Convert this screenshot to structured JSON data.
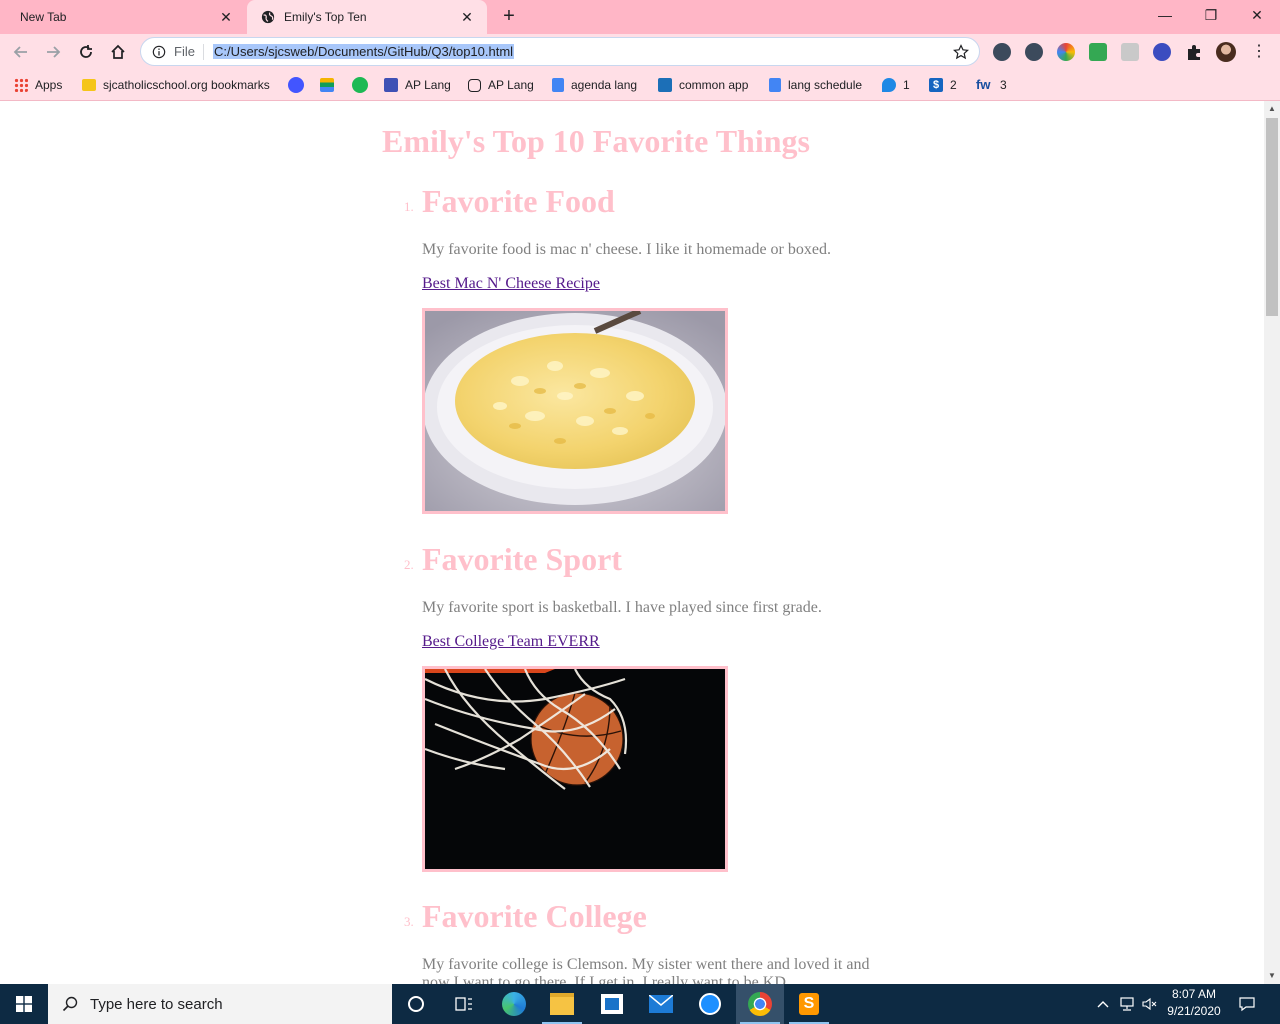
{
  "browser": {
    "tabs": [
      {
        "label": "New Tab",
        "active": false
      },
      {
        "label": "Emily's Top Ten",
        "active": true
      }
    ],
    "address_scheme": "File",
    "address_url": "C:/Users/sjcsweb/Documents/GitHub/Q3/top10.html",
    "bookmarks": [
      {
        "label": "Apps",
        "icon": "apps-grid-icon"
      },
      {
        "label": "sjcatholicschool.org bookmarks",
        "icon": "folder-icon"
      },
      {
        "label": "",
        "icon": "quizlet-icon"
      },
      {
        "label": "",
        "icon": "layers-icon"
      },
      {
        "label": "",
        "icon": "spotify-icon"
      },
      {
        "label": "AP Lang",
        "icon": "classroom-icon"
      },
      {
        "label": "AP Lang",
        "icon": "hand-icon"
      },
      {
        "label": "agenda lang",
        "icon": "docs-icon"
      },
      {
        "label": "common app",
        "icon": "commonapp-icon"
      },
      {
        "label": "lang schedule",
        "icon": "docs-icon"
      },
      {
        "label": "1",
        "icon": "chat-bubble-icon"
      },
      {
        "label": "2",
        "icon": "dollar-icon"
      },
      {
        "label": "3",
        "icon": "fw-icon"
      }
    ]
  },
  "page": {
    "title": "Emily's Top 10 Favorite Things",
    "items": [
      {
        "number": "1.",
        "heading": "Favorite Food",
        "text": "My favorite food is mac n' cheese. I like it homemade or boxed.",
        "link": "Best Mac N' Cheese Recipe",
        "image": "mac-and-cheese-photo"
      },
      {
        "number": "2.",
        "heading": "Favorite Sport",
        "text": "My favorite sport is basketball. I have played since first grade.",
        "link": "Best College Team EVERR",
        "image": "basketball-net-photo"
      },
      {
        "number": "3.",
        "heading": "Favorite College",
        "text": "My favorite college is Clemson. My sister went there and loved it and now I want to go there. If I get in. I really want to be KD"
      }
    ]
  },
  "taskbar": {
    "search_placeholder": "Type here to search",
    "time": "8:07 AM",
    "date": "9/21/2020"
  },
  "colors": {
    "tabstrip": "#ffb6c6",
    "toolbar": "#ffdfe6",
    "heading_pink": "#ffc0cb",
    "taskbar": "#0d2a43"
  }
}
